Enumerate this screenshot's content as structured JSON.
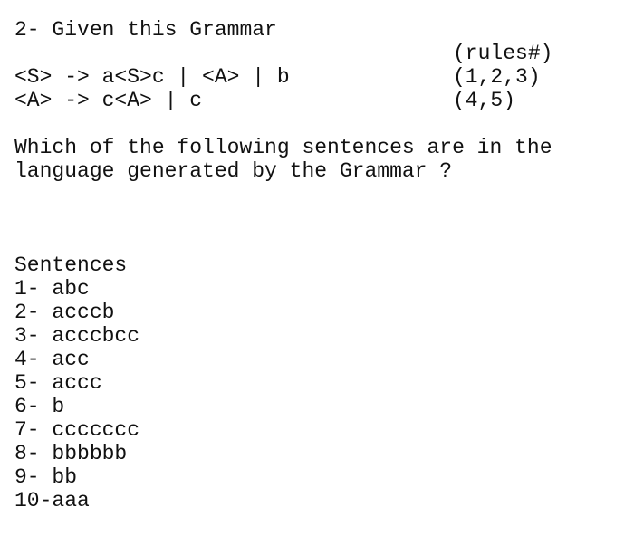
{
  "document": {
    "question_number": "2-",
    "heading": "2- Given this Grammar",
    "background_color": "#ffffff",
    "text_color": "#111111"
  },
  "grammar": {
    "rules_header": "(rules#)",
    "productions": [
      {
        "text": "<S> -> a<S>c | <A> | b",
        "rule_numbers": "(1,2,3)"
      },
      {
        "text": "<A> -> c<A> | c",
        "rule_numbers": "(4,5)"
      }
    ]
  },
  "prompt": {
    "line1": "Which of the following sentences are in the",
    "line2": "language generated by the Grammar ?"
  },
  "sentences": {
    "title": "Sentences",
    "items": [
      {
        "index": "1- ",
        "text": "abc"
      },
      {
        "index": "2- ",
        "text": "acccb"
      },
      {
        "index": "3- ",
        "text": "acccbcc"
      },
      {
        "index": "4- ",
        "text": "acc"
      },
      {
        "index": "5- ",
        "text": "accc"
      },
      {
        "index": "6- ",
        "text": "b"
      },
      {
        "index": "7- ",
        "text": "ccccccc"
      },
      {
        "index": "8- ",
        "text": "bbbbbb"
      },
      {
        "index": "9- ",
        "text": "bb"
      },
      {
        "index": "10-",
        "text": "aaa"
      }
    ]
  }
}
